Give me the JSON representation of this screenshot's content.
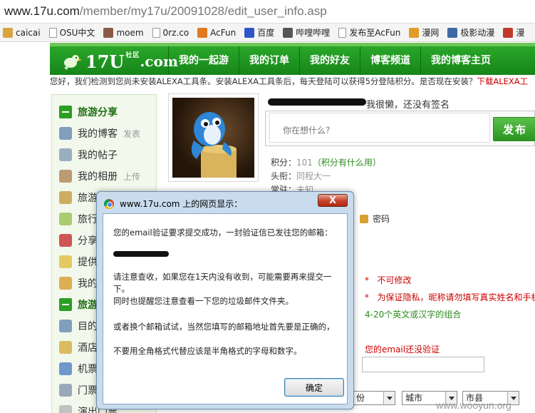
{
  "browser": {
    "url_host": "www.17u.com",
    "url_path": "/member/my17u/20091028/edit_user_info.asp",
    "bookmarks": [
      {
        "label": "caicai",
        "color": "#d9a441"
      },
      {
        "label": "OSU中文",
        "color": "#ffffff"
      },
      {
        "label": "moem",
        "color": "#8a5a44"
      },
      {
        "label": "0rz.co",
        "color": "#ffffff"
      },
      {
        "label": "AcFun",
        "color": "#e07a1e"
      },
      {
        "label": "百度",
        "color": "#2f56c9"
      },
      {
        "label": "哔哩哔哩",
        "color": "#555555"
      },
      {
        "label": "发布至AcFun",
        "color": "#ffffff"
      },
      {
        "label": "漫网",
        "color": "#e39b28"
      },
      {
        "label": "极影动漫",
        "color": "#3d6aa5"
      },
      {
        "label": "漫",
        "color": "#c0392b"
      }
    ]
  },
  "site": {
    "logo_text": "17U",
    "logo_com": ".com",
    "logo_small": "社区",
    "nav": [
      "我的一起游",
      "我的订单",
      "我的好友",
      "博客频道",
      "我的博客主页"
    ],
    "alexa_text": "您好，我们检测到您尚未安装ALEXA工具条。安装ALEXA工具条后，每天登陆可以获得5分登陆积分。是否现在安装？",
    "alexa_link": "下载ALEXA工"
  },
  "sidebar": {
    "items": [
      {
        "label": "旅游分享",
        "sub": "",
        "head": true,
        "color": "#2b9e24"
      },
      {
        "label": "我的博客",
        "sub": "发表",
        "head": false,
        "color": "#6d8fb5"
      },
      {
        "label": "我的帖子",
        "sub": "",
        "head": false,
        "color": "#8aa1b8"
      },
      {
        "label": "我的相册",
        "sub": "上传",
        "head": false,
        "color": "#b08b5e"
      },
      {
        "label": "旅游",
        "sub": "",
        "head": false,
        "color": "#c7a04a"
      },
      {
        "label": "旅行",
        "sub": "",
        "head": false,
        "color": "#9ec45c"
      },
      {
        "label": "分享",
        "sub": "",
        "head": false,
        "color": "#c83a3a"
      },
      {
        "label": "提供",
        "sub": "",
        "head": false,
        "color": "#e0c24a"
      },
      {
        "label": "我的",
        "sub": "",
        "head": false,
        "color": "#d9a13a"
      },
      {
        "label": "旅游",
        "sub": "",
        "head": true,
        "color": "#2b9e24"
      },
      {
        "label": "目的",
        "sub": "",
        "head": false,
        "color": "#6d8fb5"
      },
      {
        "label": "酒店",
        "sub": "",
        "head": false,
        "color": "#d6b04a"
      },
      {
        "label": "机票",
        "sub": "",
        "head": false,
        "color": "#5b86c4"
      },
      {
        "label": "门票",
        "sub": "",
        "head": false,
        "color": "#8a9ab0"
      },
      {
        "label": "演出门票",
        "sub": "",
        "head": false,
        "color": "#b9b9b9"
      }
    ]
  },
  "profile": {
    "status": "我很懒，还没有签名",
    "status_placeholder": "你在想什么？",
    "publish_label": "发布",
    "points_label": "积分：",
    "points_value": "101",
    "points_link": "（积分有什么用）",
    "title_label": "头衔：",
    "title_value": "同程大一",
    "resident_label": "常驻：",
    "resident_value": "未知",
    "password_label": "密码"
  },
  "form": {
    "note_readonly": "不可修改",
    "note_privacy": "为保证隐私，昵称请勿填写真实姓名和手机",
    "note_length": "4-20个英文或汉字的组合",
    "star": "*",
    "email_unverified": "您的email还没验证",
    "sel_province": "份",
    "sel_city": "城市",
    "sel_county": "市县"
  },
  "dialog": {
    "title": "www.17u.com 上的网页显示：",
    "close_label": "X",
    "line1": "您的email验证要求提交成功，一封验证信已发往您的邮箱：",
    "line2": "请注意查收，如果您在1天内没有收到，可能需要再来提交一下。",
    "line3": "同时也提醒您注意查看一下您的垃圾邮件文件夹。",
    "line4": "或者换个邮箱试试，当然您填写的邮箱地址首先要是正确的，",
    "line5": "不要用全角格式代替应该是半角格式的字母和数字。",
    "ok_label": "确定"
  },
  "watermark": "www.wooyun.org"
}
